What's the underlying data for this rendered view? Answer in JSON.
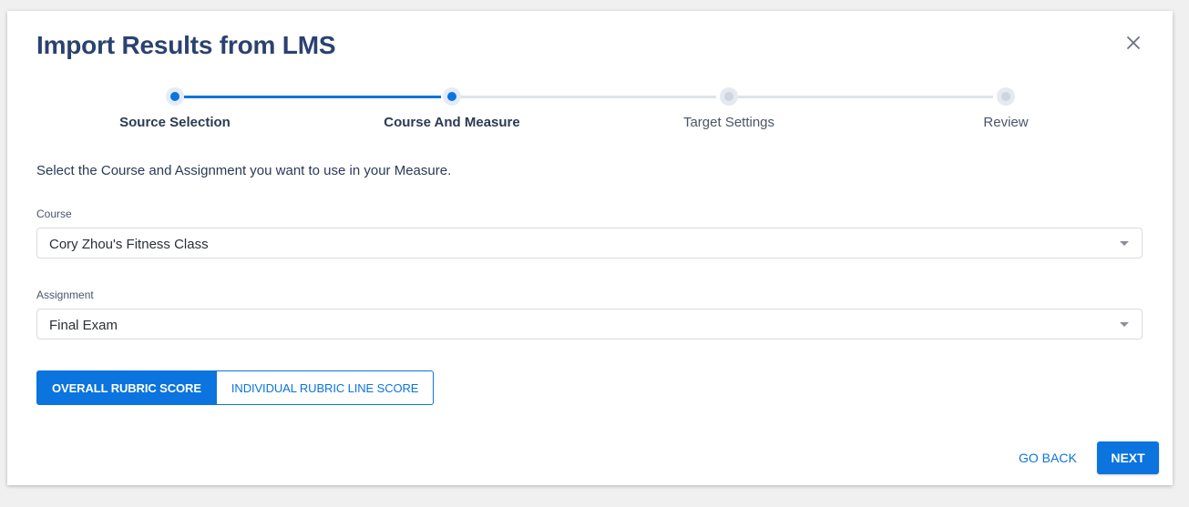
{
  "dialog": {
    "title": "Import Results from LMS",
    "close_icon": "close-icon"
  },
  "stepper": {
    "steps": [
      {
        "label": "Source Selection",
        "state": "completed"
      },
      {
        "label": "Course And Measure",
        "state": "active"
      },
      {
        "label": "Target Settings",
        "state": "pending"
      },
      {
        "label": "Review",
        "state": "pending"
      }
    ]
  },
  "instructions": "Select the Course and Assignment you want to use in your Measure.",
  "course": {
    "label": "Course",
    "value": "Cory Zhou's Fitness Class"
  },
  "assignment": {
    "label": "Assignment",
    "value": "Final Exam"
  },
  "score_toggle": {
    "overall_label": "OVERALL RUBRIC SCORE",
    "individual_label": "INDIVIDUAL RUBRIC LINE SCORE",
    "selected": "overall"
  },
  "footer": {
    "go_back_label": "GO BACK",
    "next_label": "NEXT"
  },
  "colors": {
    "accent": "#0b74de",
    "title": "#2b4270",
    "pending": "#dfe3ea"
  }
}
